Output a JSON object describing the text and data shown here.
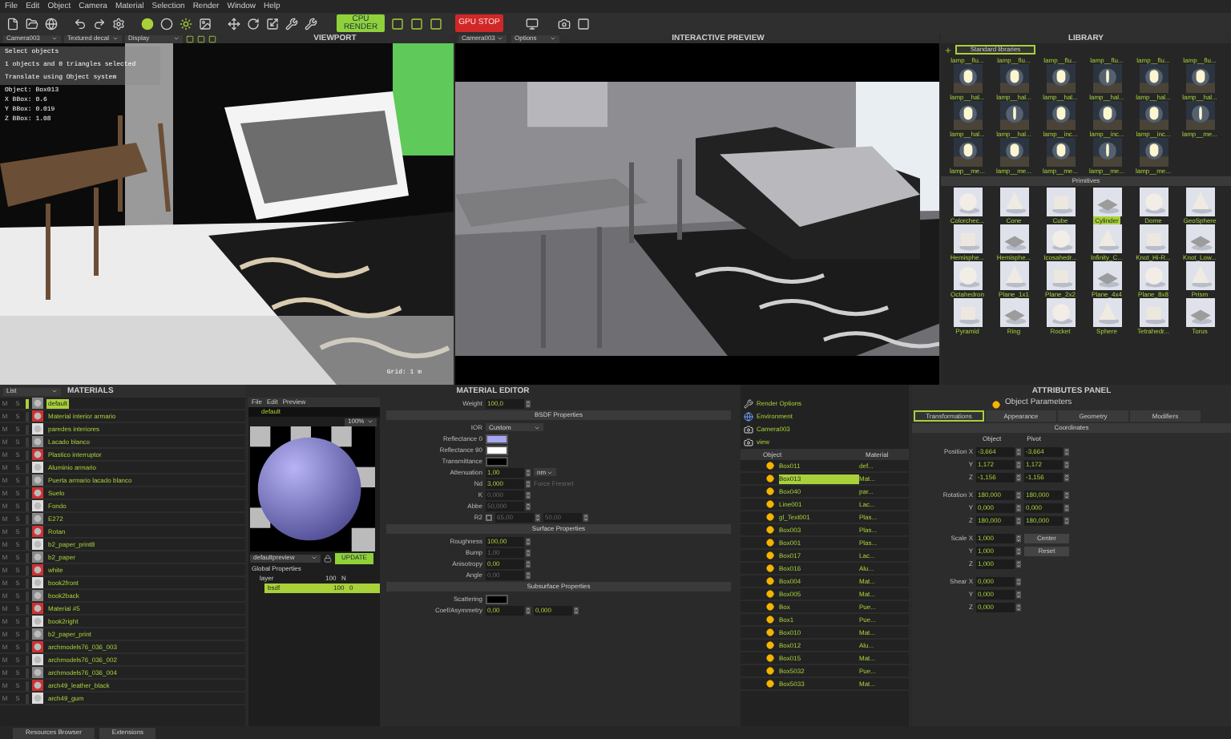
{
  "menu": [
    "File",
    "Edit",
    "Object",
    "Camera",
    "Material",
    "Selection",
    "Render",
    "Window",
    "Help"
  ],
  "toolbar": {
    "render_button": "CPU RENDER",
    "stop_button": "GPU STOP"
  },
  "viewport": {
    "title": "VIEWPORT",
    "camera": "Camera003",
    "shading": "Textured decal",
    "display": "Display",
    "messages": [
      "Select objects",
      "1 objects and 0 triangles selected",
      "Translate using Object system"
    ],
    "info": [
      "Object: Box013",
      "X BBox: 0.6",
      "Y BBox: 0.019",
      "Z BBox: 1.08"
    ],
    "grid": "Grid: 1 m"
  },
  "preview": {
    "title": "INTERACTIVE PREVIEW",
    "camera": "Camera003",
    "options": "Options"
  },
  "library": {
    "title": "LIBRARY",
    "source": "Standard libraries",
    "top_labels": [
      "lamp__flu...",
      "lamp__flu...",
      "lamp__flu...",
      "lamp__flu...",
      "lamp__flu...",
      "lamp__flu..."
    ],
    "lamps": [
      {
        "label": "lamp__hal...",
        "selected": false
      },
      {
        "label": "lamp__hal...",
        "selected": false
      },
      {
        "label": "lamp__hal...",
        "selected": false
      },
      {
        "label": "lamp__hal...",
        "selected": false
      },
      {
        "label": "lamp__hal...",
        "selected": false
      },
      {
        "label": "lamp__hal...",
        "selected": false
      },
      {
        "label": "lamp__hal...",
        "selected": false
      },
      {
        "label": "lamp__hal...",
        "selected": false
      },
      {
        "label": "lamp__inc...",
        "selected": false
      },
      {
        "label": "lamp__inc...",
        "selected": false
      },
      {
        "label": "lamp__inc...",
        "selected": false
      },
      {
        "label": "lamp__me...",
        "selected": false
      },
      {
        "label": "lamp__me...",
        "selected": false
      },
      {
        "label": "lamp__me...",
        "selected": false
      },
      {
        "label": "lamp__me...",
        "selected": false
      },
      {
        "label": "lamp__me...",
        "selected": false
      },
      {
        "label": "lamp__me...",
        "selected": false
      }
    ],
    "section": "Primitives",
    "primitives": [
      {
        "label": "Colorchec...",
        "selected": false
      },
      {
        "label": "Cone",
        "selected": false
      },
      {
        "label": "Cube",
        "selected": false
      },
      {
        "label": "Cylinder",
        "selected": true
      },
      {
        "label": "Dome",
        "selected": false
      },
      {
        "label": "GeoSphere",
        "selected": false
      },
      {
        "label": "Hemisphe...",
        "selected": false
      },
      {
        "label": "Hemisphe...",
        "selected": false
      },
      {
        "label": "Icosahedr...",
        "selected": false
      },
      {
        "label": "Infinity_C...",
        "selected": false
      },
      {
        "label": "Knot_Hi-R...",
        "selected": false
      },
      {
        "label": "Knot_Low...",
        "selected": false
      },
      {
        "label": "Octahedron",
        "selected": false
      },
      {
        "label": "Plane_1x1",
        "selected": false
      },
      {
        "label": "Plane_2x2",
        "selected": false
      },
      {
        "label": "Plane_4x4",
        "selected": false
      },
      {
        "label": "Plane_8x8",
        "selected": false
      },
      {
        "label": "Prism",
        "selected": false
      },
      {
        "label": "Pyramid",
        "selected": false
      },
      {
        "label": "Ring",
        "selected": false
      },
      {
        "label": "Rocket",
        "selected": false
      },
      {
        "label": "Sphere",
        "selected": false
      },
      {
        "label": "Tetrahedr...",
        "selected": false
      },
      {
        "label": "Torus",
        "selected": false
      }
    ]
  },
  "materials": {
    "title": "MATERIALS",
    "view": "List",
    "items": [
      {
        "m": "M",
        "s": "S",
        "name": "default",
        "selected": true
      },
      {
        "m": "M",
        "s": "S",
        "name": "Material interior armario",
        "selected": false
      },
      {
        "m": "M",
        "s": "S",
        "name": "paredes interiores",
        "selected": false
      },
      {
        "m": "M",
        "s": "S",
        "name": "Lacado blanco",
        "selected": false
      },
      {
        "m": "M",
        "s": "S",
        "name": "Plastico interruptor",
        "selected": false
      },
      {
        "m": "M",
        "s": "S",
        "name": "Aluminio armario",
        "selected": false
      },
      {
        "m": "M",
        "s": "S",
        "name": "Puerta armario lacado blanco",
        "selected": false
      },
      {
        "m": "M",
        "s": "S",
        "name": "Suelo",
        "selected": false
      },
      {
        "m": "M",
        "s": "S",
        "name": "Fondo",
        "selected": false
      },
      {
        "m": "M",
        "s": "S",
        "name": "E272",
        "selected": false
      },
      {
        "m": "M",
        "s": "S",
        "name": "Rotan",
        "selected": false
      },
      {
        "m": "M",
        "s": "S",
        "name": "b2_paper_print8",
        "selected": false
      },
      {
        "m": "M",
        "s": "S",
        "name": "b2_paper",
        "selected": false
      },
      {
        "m": "M",
        "s": "S",
        "name": "white",
        "selected": false
      },
      {
        "m": "M",
        "s": "S",
        "name": "book2front",
        "selected": false
      },
      {
        "m": "M",
        "s": "S",
        "name": "book2back",
        "selected": false
      },
      {
        "m": "M",
        "s": "S",
        "name": "Material #5",
        "selected": false
      },
      {
        "m": "M",
        "s": "S",
        "name": "book2right",
        "selected": false
      },
      {
        "m": "M",
        "s": "S",
        "name": "b2_paper_print",
        "selected": false
      },
      {
        "m": "M",
        "s": "S",
        "name": "archmodels76_036_003",
        "selected": false
      },
      {
        "m": "M",
        "s": "S",
        "name": "archmodels76_036_002",
        "selected": false
      },
      {
        "m": "M",
        "s": "S",
        "name": "archmodels76_036_004",
        "selected": false
      },
      {
        "m": "M",
        "s": "S",
        "name": "arch49_leather_black",
        "selected": false
      },
      {
        "m": "M",
        "s": "S",
        "name": "arch49_gum",
        "selected": false
      }
    ]
  },
  "material_editor": {
    "title": "MATERIAL EDITOR",
    "menu": [
      "File",
      "Edit",
      "Preview"
    ],
    "name": "default",
    "zoom": "100%",
    "preview": "defaultpreview",
    "update": "UPDATE",
    "tree": [
      {
        "name": "Global Properties",
        "selected": false,
        "children": [
          {
            "name": "layer",
            "weight": "100",
            "flag": "N",
            "selected": false,
            "children": [
              {
                "name": "bsdf",
                "weight": "100",
                "flag": "0",
                "selected": true
              }
            ]
          }
        ]
      }
    ],
    "rows": [
      {
        "kind": "number",
        "label": "Weight",
        "value": "100,0",
        "disabled": false
      },
      {
        "kind": "section",
        "label": "BSDF Properties"
      },
      {
        "kind": "dropdown",
        "label": "IOR",
        "value": "Custom"
      },
      {
        "kind": "color",
        "label": "Reflectance 0",
        "color": "#a6a6f2"
      },
      {
        "kind": "color",
        "label": "Reflectance 90",
        "color": "#ffffff"
      },
      {
        "kind": "color",
        "label": "Transmittance",
        "color": "#000000"
      },
      {
        "kind": "number",
        "label": "Attenuation",
        "value": "1,00",
        "unit": "nm",
        "disabled": false
      },
      {
        "kind": "number",
        "label": "Nd",
        "value": "3,000",
        "option": "Force Fresnel",
        "disabled": false
      },
      {
        "kind": "number",
        "label": "K",
        "value": "0,000",
        "disabled": true
      },
      {
        "kind": "number",
        "label": "Abbe",
        "value": "50,000",
        "disabled": true
      },
      {
        "kind": "pair",
        "label": "R2",
        "value": "65,00",
        "value_2": "50,00",
        "checked": false,
        "disabled": true
      },
      {
        "kind": "section",
        "label": "Surface Properties"
      },
      {
        "kind": "number",
        "label": "Roughness",
        "value": "100,00",
        "disabled": false
      },
      {
        "kind": "number",
        "label": "Bump",
        "value": "1,00",
        "disabled": true
      },
      {
        "kind": "number",
        "label": "Anisotropy",
        "value": "0,00",
        "disabled": false
      },
      {
        "kind": "number",
        "label": "Angle",
        "value": "0,00",
        "disabled": true
      },
      {
        "kind": "section",
        "label": "Subsurface Properties"
      },
      {
        "kind": "color",
        "label": "Scattering",
        "color": "#000000"
      },
      {
        "kind": "pair",
        "label": "Coef/Asymmetry",
        "value": "0,00",
        "value_2": "0,000",
        "disabled": false
      }
    ]
  },
  "scene_tree": {
    "top": [
      {
        "label": "Render Options",
        "kind": "render"
      },
      {
        "label": "Environment",
        "kind": "environment"
      },
      {
        "label": "Camera003",
        "kind": "camera"
      },
      {
        "label": "view",
        "kind": "camera"
      }
    ],
    "columns": [
      "Object",
      "Material"
    ],
    "rows": [
      {
        "object": "Box011",
        "material": "def...",
        "selected": false
      },
      {
        "object": "Box013",
        "material": "Mat...",
        "selected": true
      },
      {
        "object": "Box040",
        "material": "par...",
        "selected": false
      },
      {
        "object": "Line001",
        "material": "Lac...",
        "selected": false
      },
      {
        "object": "gl_Text001",
        "material": "Plas...",
        "selected": false
      },
      {
        "object": "Box003",
        "material": "Plas...",
        "selected": false
      },
      {
        "object": "Box001",
        "material": "Plas...",
        "selected": false
      },
      {
        "object": "Box017",
        "material": "Lac...",
        "selected": false
      },
      {
        "object": "Box016",
        "material": "Alu...",
        "selected": false
      },
      {
        "object": "Box004",
        "material": "Mat...",
        "selected": false
      },
      {
        "object": "Box005",
        "material": "Mat...",
        "selected": false
      },
      {
        "object": "Box",
        "material": "Pue...",
        "selected": false
      },
      {
        "object": "Box1",
        "material": "Pue...",
        "selected": false
      },
      {
        "object": "Box010",
        "material": "Mat...",
        "selected": false
      },
      {
        "object": "Box012",
        "material": "Alu...",
        "selected": false
      },
      {
        "object": "Box015",
        "material": "Mat...",
        "selected": false
      },
      {
        "object": "Box5032",
        "material": "Pue...",
        "selected": false
      },
      {
        "object": "Box5033",
        "material": "Mat...",
        "selected": false
      }
    ]
  },
  "attributes": {
    "title": "ATTRIBUTES PANEL",
    "heading": "Object Parameters",
    "tabs": [
      {
        "label": "Transformations",
        "selected": true
      },
      {
        "label": "Appearance",
        "selected": false
      },
      {
        "label": "Geometry",
        "selected": false
      },
      {
        "label": "Modifiers",
        "selected": false
      }
    ],
    "section": "Coordinates",
    "columns": [
      "Object",
      "Pivot"
    ],
    "rows": [
      {
        "kind": "pair",
        "label": "Position X",
        "object": "-3,664",
        "pivot": "-3,664"
      },
      {
        "kind": "pair",
        "label": "Y",
        "object": "1,172",
        "pivot": "1,172"
      },
      {
        "kind": "pair",
        "label": "Z",
        "object": "-1,156",
        "pivot": "-1,156"
      },
      {
        "kind": "gap"
      },
      {
        "kind": "pair",
        "label": "Rotation X",
        "object": "180,000",
        "pivot": "180,000"
      },
      {
        "kind": "pair",
        "label": "Y",
        "object": "0,000",
        "pivot": "0,000"
      },
      {
        "kind": "pair",
        "label": "Z",
        "object": "180,000",
        "pivot": "180,000"
      },
      {
        "kind": "gap"
      },
      {
        "kind": "button",
        "label": "Scale X",
        "object": "1,000",
        "button": "Center"
      },
      {
        "kind": "button",
        "label": "Y",
        "object": "1,000",
        "button": "Reset"
      },
      {
        "kind": "single",
        "label": "Z",
        "object": "1,000"
      },
      {
        "kind": "gap"
      },
      {
        "kind": "single",
        "label": "Shear X",
        "object": "0,000"
      },
      {
        "kind": "single",
        "label": "Y",
        "object": "0,000"
      },
      {
        "kind": "single",
        "label": "Z",
        "object": "0,000"
      }
    ]
  },
  "footer_tabs": [
    "Resources Browser",
    "Extensions"
  ]
}
